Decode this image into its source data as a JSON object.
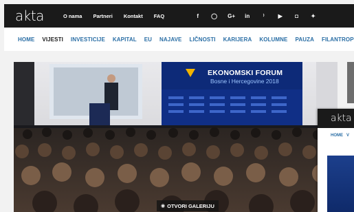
{
  "brand": {
    "logo_text": "akta"
  },
  "top_links": [
    "O nama",
    "Partneri",
    "Kontakt",
    "FAQ"
  ],
  "social_icons": [
    {
      "name": "facebook-icon",
      "glyph": "f"
    },
    {
      "name": "whatsapp-icon",
      "glyph": "◯"
    },
    {
      "name": "google-plus-icon",
      "glyph": "G+"
    },
    {
      "name": "linkedin-icon",
      "glyph": "in"
    },
    {
      "name": "rss-icon",
      "glyph": "⁾"
    },
    {
      "name": "youtube-icon",
      "glyph": "▶"
    },
    {
      "name": "instagram-icon",
      "glyph": "◘"
    },
    {
      "name": "twitter-icon",
      "glyph": "✦"
    }
  ],
  "nav": {
    "active": "VIJESTI",
    "items": [
      "HOME",
      "VIJESTI",
      "INVESTICIJE",
      "KAPITAL",
      "EU",
      "NAJAVE",
      "LIČNOSTI",
      "KARIJERA",
      "KOLUMNE",
      "PAUZA",
      "FILANTROPIJA"
    ]
  },
  "hero": {
    "banner_title": "EKONOMSKI FORUM",
    "banner_subtitle": "Bosne i Hercegovine 2018",
    "gallery_button_label": "OTVORI GALERIJU",
    "gallery_icon": "camera-icon"
  },
  "thumbnail": {
    "logo_text": "akta",
    "nav_items": [
      "HOME",
      "V"
    ]
  },
  "colors": {
    "topbar": "#1a1a1a",
    "nav_link": "#2a6ea5",
    "nav_active": "#1a1a1a",
    "banner_blue": "#0d2a78"
  }
}
